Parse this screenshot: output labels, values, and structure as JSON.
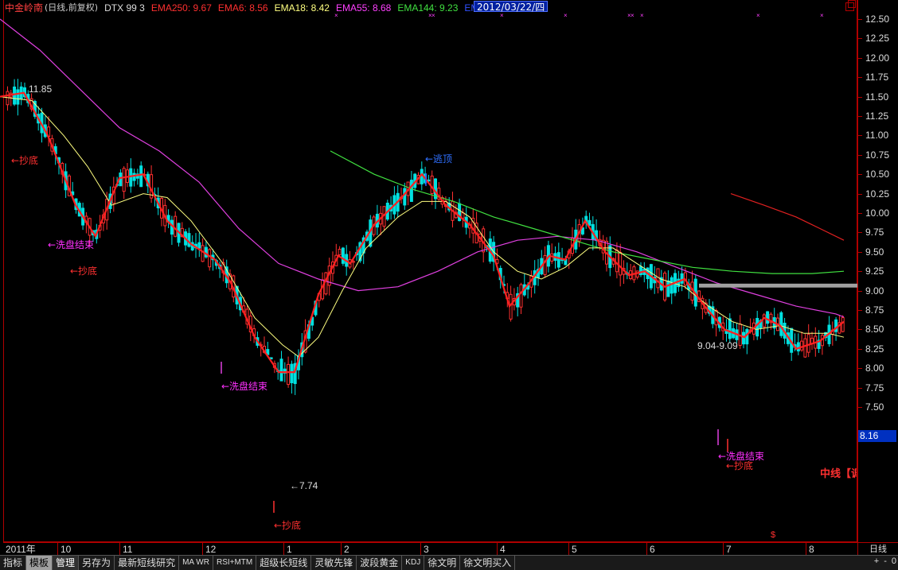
{
  "header": {
    "stock_name": "中金岭南",
    "mode": "(日线,前复权)",
    "indicator": "DTX 99 3",
    "ema250": "EMA250: 9.67",
    "ema6": "EMA6: 8.56",
    "ema18": "EMA18: 8.42",
    "ema55": "EMA55: 8.68",
    "ema144": "EMA144: 9.23",
    "ema288": "EMA288: -"
  },
  "colors": {
    "up": "#ff3030",
    "down": "#00e0e0",
    "ema6": "#ff2020",
    "ema18": "#ffff80",
    "ema55": "#e040e0",
    "ema144": "#40e040",
    "ema250": "#e02020",
    "ema288": "#3050ff",
    "frame": "#b00000"
  },
  "price_axis": {
    "ticks": [
      "12.50",
      "12.25",
      "12.00",
      "11.75",
      "11.50",
      "11.25",
      "11.00",
      "10.75",
      "10.50",
      "10.25",
      "10.00",
      "9.75",
      "9.50",
      "9.25",
      "9.00",
      "8.75",
      "8.50",
      "8.25",
      "8.00",
      "7.75",
      "7.50"
    ],
    "current": "8.16"
  },
  "annotations": {
    "high_label": "11.85",
    "low_label": "←7.74",
    "range_label": "9.04-9.09",
    "chaodi_1": "←抄底",
    "chaodi_2": "←抄底",
    "chaodi_3": "←抄底",
    "chaodi_4": "←抄底",
    "xipan_1": "←洗盘结束",
    "xipan_2": "←洗盘结束",
    "xipan_3": "←洗盘结束",
    "taoding": "←逃顶",
    "zhongxian": "中线【调"
  },
  "date_axis": {
    "labels": [
      "2011年",
      "10",
      "11",
      "12",
      "1",
      "2",
      "3",
      "4",
      "5",
      "6",
      "7",
      "8"
    ],
    "cursor": "2012/03/22/四",
    "period": "日线"
  },
  "tabs": [
    {
      "label": "指标",
      "state": "normal"
    },
    {
      "label": "模板",
      "state": "active"
    },
    {
      "label": "管理",
      "state": "selected"
    },
    {
      "label": "另存为",
      "state": "normal"
    },
    {
      "label": "最新短线研究",
      "state": "normal"
    },
    {
      "label": "MA WR",
      "state": "small"
    },
    {
      "label": "RSI+MTM",
      "state": "small"
    },
    {
      "label": "超级长短线",
      "state": "normal"
    },
    {
      "label": "灵敏先锋",
      "state": "normal"
    },
    {
      "label": "波段黄金",
      "state": "normal"
    },
    {
      "label": "KDJ",
      "state": "small"
    },
    {
      "label": "徐文明",
      "state": "normal"
    },
    {
      "label": "徐文明买入",
      "state": "normal"
    }
  ],
  "nav": {
    "add": "+",
    "sub": "-",
    "zero": "0"
  },
  "chart_data": {
    "type": "candlestick",
    "y_range": [
      7.35,
      12.6
    ],
    "ema6": [
      [
        0,
        11.5
      ],
      [
        30,
        11.55
      ],
      [
        60,
        11.0
      ],
      [
        95,
        10.1
      ],
      [
        120,
        9.7
      ],
      [
        150,
        10.45
      ],
      [
        180,
        10.5
      ],
      [
        210,
        9.9
      ],
      [
        240,
        9.6
      ],
      [
        270,
        9.4
      ],
      [
        290,
        9.1
      ],
      [
        320,
        8.4
      ],
      [
        350,
        7.95
      ],
      [
        370,
        7.95
      ],
      [
        400,
        8.95
      ],
      [
        425,
        9.45
      ],
      [
        440,
        9.35
      ],
      [
        470,
        9.85
      ],
      [
        500,
        10.15
      ],
      [
        530,
        10.5
      ],
      [
        560,
        10.1
      ],
      [
        590,
        9.85
      ],
      [
        620,
        9.45
      ],
      [
        640,
        8.8
      ],
      [
        665,
        9.1
      ],
      [
        690,
        9.45
      ],
      [
        710,
        9.4
      ],
      [
        735,
        9.9
      ],
      [
        760,
        9.5
      ],
      [
        790,
        9.2
      ],
      [
        810,
        9.25
      ],
      [
        835,
        9.05
      ],
      [
        860,
        9.15
      ],
      [
        885,
        8.8
      ],
      [
        910,
        8.5
      ],
      [
        935,
        8.4
      ],
      [
        960,
        8.65
      ],
      [
        980,
        8.55
      ],
      [
        1000,
        8.25
      ],
      [
        1030,
        8.35
      ],
      [
        1060,
        8.6
      ]
    ],
    "ema18": [
      [
        0,
        11.5
      ],
      [
        40,
        11.45
      ],
      [
        80,
        11.0
      ],
      [
        110,
        10.6
      ],
      [
        140,
        10.1
      ],
      [
        180,
        10.25
      ],
      [
        210,
        10.2
      ],
      [
        240,
        9.9
      ],
      [
        280,
        9.35
      ],
      [
        320,
        8.65
      ],
      [
        355,
        8.3
      ],
      [
        375,
        8.15
      ],
      [
        400,
        8.4
      ],
      [
        430,
        9.0
      ],
      [
        460,
        9.55
      ],
      [
        500,
        9.95
      ],
      [
        530,
        10.15
      ],
      [
        560,
        10.15
      ],
      [
        590,
        9.95
      ],
      [
        620,
        9.5
      ],
      [
        650,
        9.25
      ],
      [
        680,
        9.15
      ],
      [
        710,
        9.3
      ],
      [
        740,
        9.55
      ],
      [
        770,
        9.55
      ],
      [
        800,
        9.35
      ],
      [
        830,
        9.15
      ],
      [
        860,
        9.05
      ],
      [
        890,
        8.8
      ],
      [
        920,
        8.6
      ],
      [
        950,
        8.5
      ],
      [
        980,
        8.55
      ],
      [
        1010,
        8.45
      ],
      [
        1040,
        8.45
      ],
      [
        1060,
        8.4
      ]
    ],
    "ema55": [
      [
        0,
        12.5
      ],
      [
        50,
        12.1
      ],
      [
        100,
        11.6
      ],
      [
        150,
        11.1
      ],
      [
        200,
        10.8
      ],
      [
        250,
        10.4
      ],
      [
        300,
        9.8
      ],
      [
        350,
        9.35
      ],
      [
        400,
        9.15
      ],
      [
        450,
        9.0
      ],
      [
        500,
        9.05
      ],
      [
        550,
        9.25
      ],
      [
        600,
        9.5
      ],
      [
        650,
        9.65
      ],
      [
        700,
        9.7
      ],
      [
        750,
        9.65
      ],
      [
        800,
        9.5
      ],
      [
        850,
        9.3
      ],
      [
        900,
        9.1
      ],
      [
        950,
        8.95
      ],
      [
        1000,
        8.8
      ],
      [
        1050,
        8.7
      ],
      [
        1060,
        8.66
      ]
    ],
    "ema144": [
      [
        415,
        10.8
      ],
      [
        470,
        10.5
      ],
      [
        520,
        10.3
      ],
      [
        570,
        10.15
      ],
      [
        620,
        9.95
      ],
      [
        670,
        9.8
      ],
      [
        720,
        9.65
      ],
      [
        770,
        9.5
      ],
      [
        820,
        9.4
      ],
      [
        870,
        9.3
      ],
      [
        920,
        9.25
      ],
      [
        970,
        9.22
      ],
      [
        1020,
        9.22
      ],
      [
        1060,
        9.25
      ]
    ],
    "ema250": [
      [
        918,
        10.25
      ],
      [
        960,
        10.1
      ],
      [
        1000,
        9.95
      ],
      [
        1030,
        9.8
      ],
      [
        1060,
        9.65
      ]
    ],
    "resistance_band": [
      9.04,
      9.09
    ]
  }
}
